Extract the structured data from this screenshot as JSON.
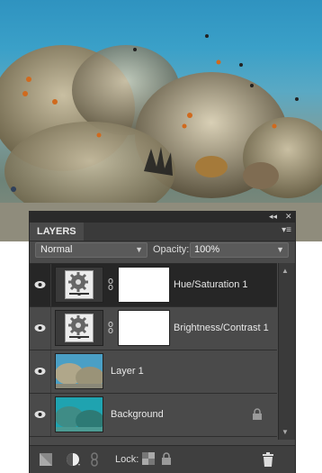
{
  "panel": {
    "tab_label": "LAYERS",
    "collapse_glyph": "◂◂",
    "close_glyph": "✕",
    "menu_glyph": "▾≡"
  },
  "options": {
    "blend_mode": "Normal",
    "opacity_label": "Opacity:",
    "opacity_value": "100%"
  },
  "layers": [
    {
      "name": "Hue/Saturation 1",
      "type": "adjustment",
      "selected": true
    },
    {
      "name": "Brightness/Contrast 1",
      "type": "adjustment",
      "selected": false
    },
    {
      "name": "Layer 1",
      "type": "pixel",
      "selected": false
    },
    {
      "name": "Background",
      "type": "pixel",
      "locked": true,
      "selected": false
    }
  ],
  "bottom": {
    "lock_label": "Lock:"
  },
  "icons": [
    "eye-icon",
    "gear-adjustment-icon",
    "link-chain-icon",
    "lock-icon",
    "new-layer-icon",
    "adjustment-layer-icon",
    "link-layers-icon",
    "lock-transparency-icon",
    "lock-all-icon",
    "trash-icon"
  ]
}
